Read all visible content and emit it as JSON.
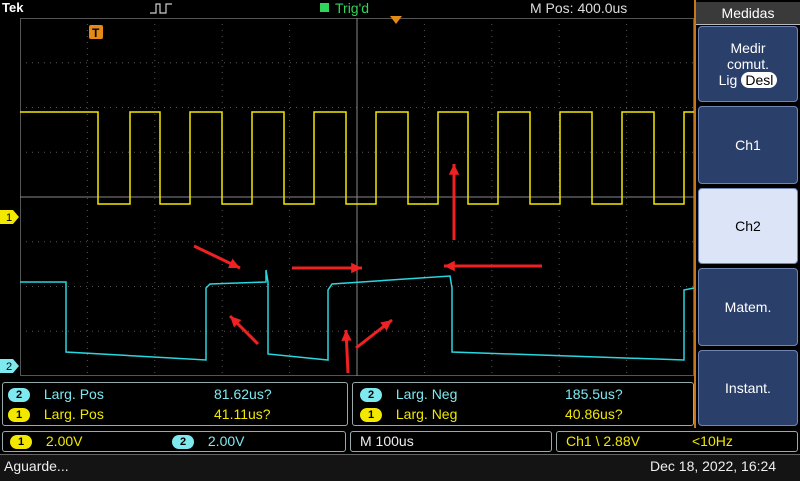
{
  "header": {
    "brand": "Tek",
    "trigger_status": "Trig'd",
    "position_label": "M Pos: 400.0us"
  },
  "markers": {
    "ch1": "1",
    "ch2": "2",
    "trigger": "T"
  },
  "menu": {
    "title": "Medidas",
    "items": [
      {
        "label_lines": [
          "Medir",
          "comut."
        ],
        "toggle_left": "Lig",
        "toggle_right": "Desl"
      },
      {
        "label": "Ch1"
      },
      {
        "label": "Ch2"
      },
      {
        "label": "Matem."
      },
      {
        "label": "Instant."
      }
    ]
  },
  "measurements": {
    "left": [
      {
        "channel": "2",
        "name": "Larg. Pos",
        "value": "81.62us?"
      },
      {
        "channel": "1",
        "name": "Larg. Pos",
        "value": "41.11us?"
      }
    ],
    "right": [
      {
        "channel": "2",
        "name": "Larg. Neg",
        "value": "185.5us?"
      },
      {
        "channel": "1",
        "name": "Larg. Neg",
        "value": "40.86us?"
      }
    ]
  },
  "scale_bar": {
    "ch1": {
      "channel": "1",
      "value": "2.00V"
    },
    "ch2": {
      "channel": "2",
      "value": "2.00V"
    },
    "timebase": "M 100us",
    "trigger": "Ch1 \\ 2.88V",
    "trigger_freq": "<10Hz"
  },
  "status": {
    "text": "Aguarde...",
    "datetime": "Dec 18, 2022, 16:24"
  },
  "colors": {
    "ch1": "#f2e800",
    "ch2": "#28d8e0",
    "annotation": "#ee2222",
    "grid": "#555555"
  }
}
